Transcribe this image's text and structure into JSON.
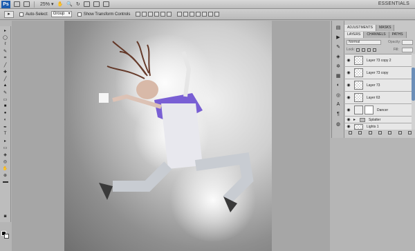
{
  "appbar": {
    "logo": "Ps",
    "zoom": "25%",
    "workspace": "ESSENTIALS"
  },
  "options": {
    "tool_glyph": "▸",
    "auto_select_label": "Auto-Select:",
    "auto_select_value": "Group",
    "show_transform_label": "Show Transform Controls"
  },
  "panel": {
    "top_tabs": [
      "ADJUSTMENTS",
      "MASKS"
    ],
    "tabs": [
      "LAYERS",
      "CHANNELS",
      "PATHS"
    ],
    "blend_mode": "Normal",
    "opacity_label": "Opacity:",
    "lock_label": "Lock:",
    "fill_label": "Fill:",
    "layers": [
      {
        "name": "Layer 73 copy 2"
      },
      {
        "name": "Layer 73 copy"
      },
      {
        "name": "Layer 73"
      },
      {
        "name": "Layer 63"
      },
      {
        "name": "Dancer"
      },
      {
        "name": "Splatter"
      },
      {
        "name": "Lights 1"
      }
    ]
  },
  "icons": {
    "eye": "◉",
    "triangle": "▸"
  }
}
